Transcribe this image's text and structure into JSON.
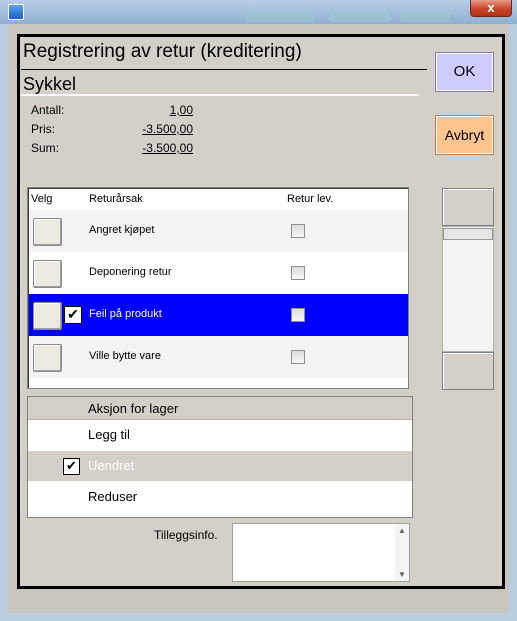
{
  "window": {
    "close_glyph": "x",
    "app_icon": "app-icon"
  },
  "dialog": {
    "title": "Registrering av retur (kreditering)",
    "product": "Sykkel"
  },
  "fields": [
    {
      "label": "Antall:",
      "value": "1,00"
    },
    {
      "label": "Pris:",
      "value": "-3.500,00"
    },
    {
      "label": "Sum:",
      "value": "-3.500,00"
    }
  ],
  "buttons": {
    "ok": "OK",
    "cancel": "Avbryt"
  },
  "return_table": {
    "headers": {
      "select": "Velg",
      "reason": "Returårsak",
      "returned": "Retur lev."
    },
    "rows": [
      {
        "reason": "Angret kjøpet",
        "checked": false,
        "returned": false,
        "selected": false
      },
      {
        "reason": "Deponering retur",
        "checked": false,
        "returned": false,
        "selected": false
      },
      {
        "reason": "Feil på produkt",
        "checked": true,
        "returned": false,
        "selected": true
      },
      {
        "reason": "Ville bytte vare",
        "checked": false,
        "returned": false,
        "selected": false
      }
    ]
  },
  "stock_action": {
    "header": "Aksjon for lager",
    "options": [
      {
        "label": "Legg til",
        "checked": false,
        "selected": false
      },
      {
        "label": "Uendret",
        "checked": true,
        "selected": true
      },
      {
        "label": "Reduser",
        "checked": false,
        "selected": false
      }
    ]
  },
  "additional_info": {
    "label": "Tilleggsinfo.",
    "value": ""
  },
  "colors": {
    "selected_row": "#0000ff",
    "ok_button": "#ccccff",
    "cancel_button": "#ffc38e"
  },
  "check_glyph": "✔"
}
